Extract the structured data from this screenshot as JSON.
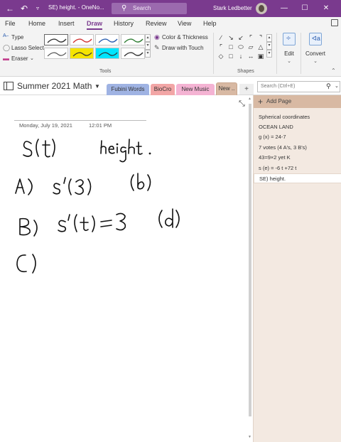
{
  "titlebar": {
    "back_icon": "back-arrow-icon",
    "undo_icon": "undo-icon",
    "qat_icon": "quick-access-dropdown-icon",
    "doc_title": "SE) height.  -  OneNo...",
    "search_label": "Search",
    "user_name": "Stark Ledbetter",
    "minimize": "—",
    "maximize": "☐",
    "close": "✕"
  },
  "menu": {
    "tabs": [
      "File",
      "Home",
      "Insert",
      "Draw",
      "History",
      "Review",
      "View",
      "Help"
    ],
    "active_tab": "Draw"
  },
  "ribbon": {
    "type_label": "Type",
    "lasso_label": "Lasso Select",
    "eraser_label": "Eraser",
    "color_thickness_label": "Color & Thickness",
    "draw_touch_label": "Draw with Touch",
    "tools_group_label": "Tools",
    "shapes_group_label": "Shapes",
    "edit_label": "Edit",
    "convert_label": "Convert",
    "pen_colors": [
      "#333333",
      "#d03030",
      "#2a5db0",
      "#2e7d32",
      "#555555",
      "#f5e400",
      "#00e5ff",
      "#333333"
    ]
  },
  "notebook": {
    "name": "Summer 2021 Math",
    "sections": [
      {
        "label": "Fubini Words",
        "color": "#9fb3e3"
      },
      {
        "label": "BioCro",
        "color": "#f2a6a6"
      },
      {
        "label": "New Music",
        "color": "#f4b3d3"
      },
      {
        "label": "New ..",
        "color": "#d8b9a3"
      }
    ],
    "add_section": "+",
    "search_placeholder": "Search (Ctrl+E)"
  },
  "page": {
    "date": "Monday, July 19, 2021",
    "time": "12:01 PM"
  },
  "pages": {
    "add_label": "Add Page",
    "items": [
      "Spherical coordinates",
      "OCEAN LAND",
      "g (x) = 24-7",
      "7 votes (4 A's, 3 B's)",
      "43=9×2 yet K",
      "s (e) = -6 t +72 t",
      "SE) height."
    ],
    "selected_index": 6
  }
}
